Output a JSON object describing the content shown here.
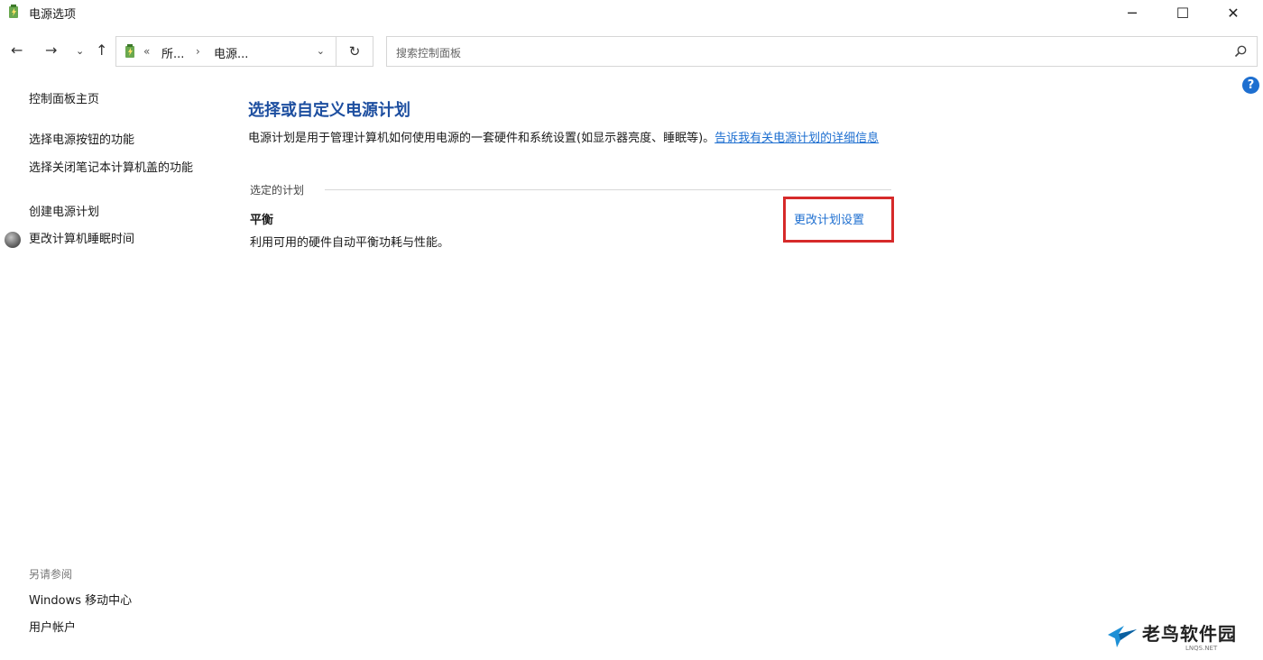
{
  "window": {
    "title": "电源选项",
    "minimize_glyph": "─",
    "maximize_glyph": "☐",
    "close_glyph": "✕"
  },
  "nav": {
    "back_glyph": "←",
    "forward_glyph": "→",
    "history_glyph": "⌄",
    "up_glyph": "↑",
    "address_sep_1": "«",
    "crumb_1": "所...",
    "address_sep_2": "›",
    "crumb_2": "电源...",
    "dropdown_glyph": "⌄",
    "refresh_glyph": "↻",
    "search_placeholder": "搜索控制面板",
    "accent_color": "#1e6fd0"
  },
  "help": {
    "glyph": "?"
  },
  "sidebar": {
    "home": "控制面板主页",
    "items": [
      {
        "label": "选择电源按钮的功能"
      },
      {
        "label": "选择关闭笔记本计算机盖的功能"
      },
      {
        "label": "创建电源计划"
      },
      {
        "label": "更改计算机睡眠时间"
      }
    ],
    "see_also_title": "另请参阅",
    "see_also": [
      {
        "label": "Windows 移动中心"
      },
      {
        "label": "用户帐户"
      }
    ]
  },
  "main": {
    "title": "选择或自定义电源计划",
    "description": "电源计划是用于管理计算机如何使用电源的一套硬件和系统设置(如显示器亮度、睡眠等)。",
    "description_link": "告诉我有关电源计划的详细信息",
    "section_label": "选定的计划",
    "plan_name": "平衡",
    "plan_description": "利用可用的硬件自动平衡功耗与性能。",
    "change_plan_link": "更改计划设置",
    "highlight_color": "#d62a2a"
  },
  "watermark": {
    "text": "老鸟软件园",
    "subtext": "LNQS.NET"
  }
}
